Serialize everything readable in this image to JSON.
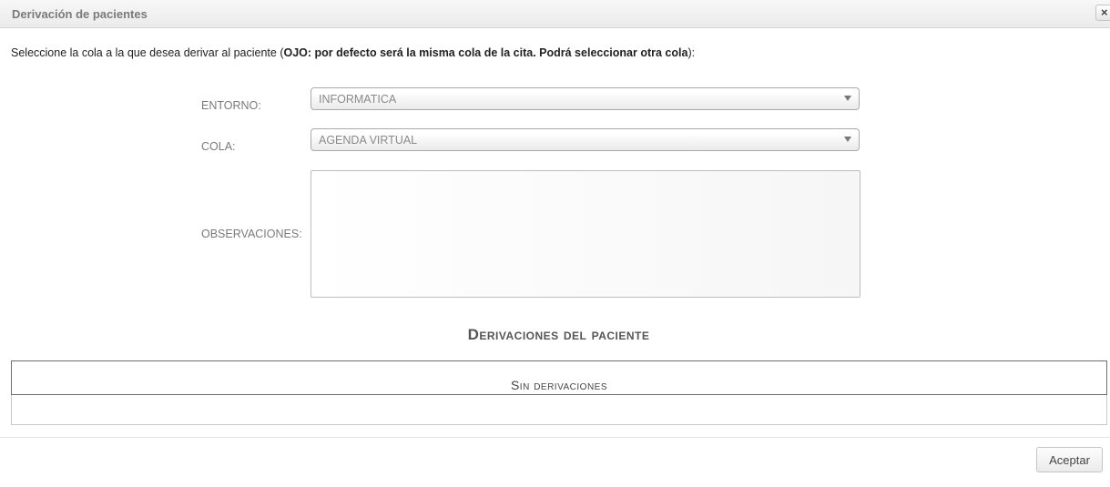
{
  "dialog": {
    "title": "Derivación de pacientes",
    "close_glyph": "×"
  },
  "intro": {
    "prefix": "Seleccione la cola a la que desea derivar al paciente (",
    "bold": "OJO: por defecto será la misma cola de la cita. Podrá seleccionar otra cola",
    "suffix": "):"
  },
  "form": {
    "entorno": {
      "label": "ENTORNO:",
      "selected": "INFORMATICA"
    },
    "cola": {
      "label": "COLA:",
      "selected": "AGENDA VIRTUAL"
    },
    "observaciones": {
      "label": "OBSERVACIONES:",
      "value": ""
    }
  },
  "derivaciones": {
    "title": "Derivaciones del paciente",
    "empty_text": "Sin derivaciones"
  },
  "footer": {
    "accept_label": "Aceptar"
  },
  "icons": {
    "close": "close-icon",
    "dropdown": "chevron-down-icon"
  }
}
